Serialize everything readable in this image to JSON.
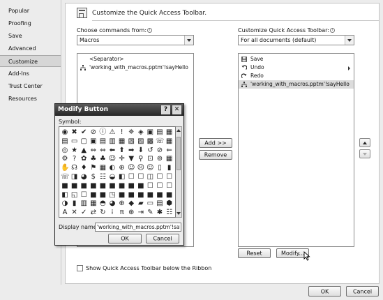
{
  "nav": {
    "items": [
      {
        "label": "Popular",
        "selected": false
      },
      {
        "label": "Proofing",
        "selected": false
      },
      {
        "label": "Save",
        "selected": false
      },
      {
        "label": "Advanced",
        "selected": false
      },
      {
        "label": "Customize",
        "selected": true
      },
      {
        "label": "Add-Ins",
        "selected": false
      },
      {
        "label": "Trust Center",
        "selected": false
      },
      {
        "label": "Resources",
        "selected": false
      }
    ]
  },
  "header": {
    "title": "Customize the Quick Access Toolbar.",
    "icon": "customize-toolbar-icon"
  },
  "left_panel": {
    "choose_label": "Choose commands from:",
    "choose_value": "Macros",
    "commands": [
      {
        "label": "<Separator>",
        "icon": ""
      },
      {
        "label": "'working_with_macros.pptm'!sayHello",
        "icon": "macro-icon"
      }
    ]
  },
  "middle": {
    "add_label": "Add >>",
    "remove_label": "Remove"
  },
  "right_panel": {
    "customize_label": "Customize Quick Access Toolbar:",
    "customize_value": "For all documents (default)",
    "items": [
      {
        "label": "Save",
        "icon": "save-icon",
        "selected": false,
        "submenu": false
      },
      {
        "label": "Undo",
        "icon": "undo-icon",
        "selected": false,
        "submenu": true
      },
      {
        "label": "Redo",
        "icon": "redo-icon",
        "selected": false,
        "submenu": false
      },
      {
        "label": "'working_with_macros.pptm'!sayHello",
        "icon": "macro-icon",
        "selected": true,
        "submenu": false
      }
    ],
    "reset_label": "Reset",
    "modify_label": "Modify..."
  },
  "show_below_ribbon_label": "Show Quick Access Toolbar below the Ribbon",
  "footer": {
    "ok_label": "OK",
    "cancel_label": "Cancel"
  },
  "modify_dialog": {
    "title": "Modify Button",
    "help_glyph": "?",
    "close_glyph": "✕",
    "symbol_label": "Symbol:",
    "display_name_label": "Display name:",
    "display_name_value": "'working_with_macros.pptm'!sayHello",
    "ok_label": "OK",
    "cancel_label": "Cancel",
    "symbols": [
      [
        "◉",
        "✖",
        "✔",
        "⊘",
        "ⓘ",
        "⚠",
        "!",
        "✵",
        "◈",
        "▣",
        "▤",
        "▦"
      ],
      [
        "▤",
        "▭",
        "▢",
        "▣",
        "▤",
        "▥",
        "▦",
        "▧",
        "▨",
        "▩",
        "☏",
        "▦"
      ],
      [
        "◎",
        "★",
        "▲",
        "⇔",
        "⇔",
        "⬅",
        "⬆",
        "➡",
        "⬇",
        "↺",
        "⊘",
        "⇐"
      ],
      [
        "⚙",
        "?",
        "✿",
        "♣",
        "♣",
        "☺",
        "✛",
        "▼",
        "⚲",
        "⊡",
        "⊚",
        "▦"
      ],
      [
        "✋",
        "☊",
        "♦",
        "⚑",
        "▦",
        "◐",
        "⊕",
        "☺",
        "☹",
        "☺",
        "▯",
        "▮"
      ],
      [
        "☏",
        "◨",
        "◕",
        "$",
        "☷",
        "◒",
        "◧",
        "☐",
        "☐",
        "◫",
        "☐",
        "☐"
      ],
      [
        "■",
        "■",
        "■",
        "■",
        "■",
        "■",
        "■",
        "■",
        "■",
        "☐",
        "☐",
        "☐"
      ],
      [
        "◧",
        "◱",
        "☐",
        "■",
        "■",
        "◳",
        "■",
        "■",
        "■",
        "■",
        "■",
        "■"
      ],
      [
        "◑",
        "▮",
        "▥",
        "▦",
        "◓",
        "◕",
        "⊕",
        "◆",
        "▰",
        "▭",
        "▤",
        "⬢"
      ],
      [
        "A",
        "✕",
        "✓",
        "⇄",
        "↻",
        "⁞",
        "π",
        "⊕",
        "⇥",
        "✎",
        "✱",
        "☷"
      ]
    ]
  }
}
